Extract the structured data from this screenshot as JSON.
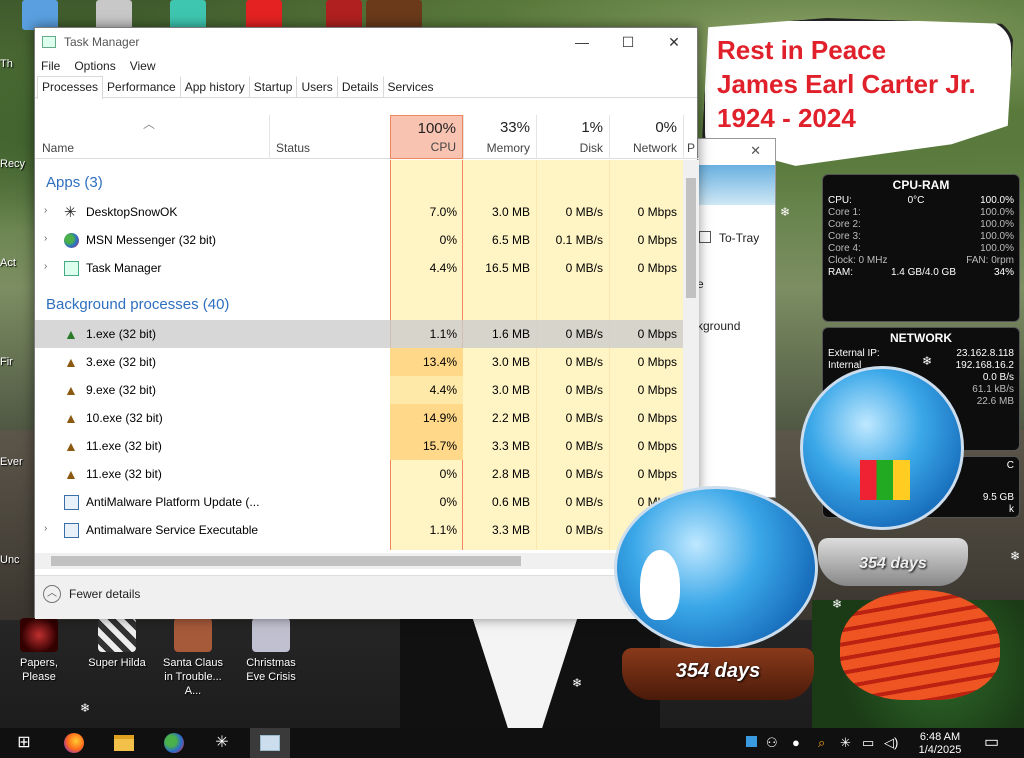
{
  "window": {
    "title": "Task Manager",
    "controls": {
      "minimize": "—",
      "maximize": "☐",
      "close": "✕"
    },
    "menu": [
      "File",
      "Options",
      "View"
    ],
    "tabs": [
      "Processes",
      "Performance",
      "App history",
      "Startup",
      "Users",
      "Details",
      "Services"
    ],
    "active_tab": "Processes"
  },
  "columns": {
    "name": "Name",
    "status": "Status",
    "cpu": {
      "pct": "100%",
      "label": "CPU"
    },
    "memory": {
      "pct": "33%",
      "label": "Memory"
    },
    "disk": {
      "pct": "1%",
      "label": "Disk"
    },
    "network": {
      "pct": "0%",
      "label": "Network"
    },
    "power": "P"
  },
  "groups": {
    "apps": "Apps (3)",
    "background": "Background processes (40)"
  },
  "apps": [
    {
      "name": "DesktopSnowOK",
      "cpu": "7.0%",
      "memory": "3.0 MB",
      "disk": "0 MB/s",
      "network": "0 Mbps",
      "icon": "snowflake-icon"
    },
    {
      "name": "MSN Messenger (32 bit)",
      "cpu": "0%",
      "memory": "6.5 MB",
      "disk": "0.1 MB/s",
      "network": "0 Mbps",
      "icon": "msn-messenger-icon"
    },
    {
      "name": "Task Manager",
      "cpu": "4.4%",
      "memory": "16.5 MB",
      "disk": "0 MB/s",
      "network": "0 Mbps",
      "icon": "task-manager-icon"
    }
  ],
  "background": [
    {
      "name": "1.exe (32 bit)",
      "cpu": "1.1%",
      "memory": "1.6 MB",
      "disk": "0 MB/s",
      "network": "0 Mbps"
    },
    {
      "name": "3.exe (32 bit)",
      "cpu": "13.4%",
      "memory": "3.0 MB",
      "disk": "0 MB/s",
      "network": "0 Mbps"
    },
    {
      "name": "9.exe (32 bit)",
      "cpu": "4.4%",
      "memory": "3.0 MB",
      "disk": "0 MB/s",
      "network": "0 Mbps"
    },
    {
      "name": "10.exe (32 bit)",
      "cpu": "14.9%",
      "memory": "2.2 MB",
      "disk": "0 MB/s",
      "network": "0 Mbps"
    },
    {
      "name": "11.exe (32 bit)",
      "cpu": "15.7%",
      "memory": "3.3 MB",
      "disk": "0 MB/s",
      "network": "0 Mbps"
    },
    {
      "name": "11.exe (32 bit)",
      "cpu": "0%",
      "memory": "2.8 MB",
      "disk": "0 MB/s",
      "network": "0 Mbps"
    },
    {
      "name": "AntiMalware Platform Update (...",
      "cpu": "0%",
      "memory": "0.6 MB",
      "disk": "0 MB/s",
      "network": "0 Mbps"
    },
    {
      "name": "Antimalware Service Executable",
      "cpu": "1.1%",
      "memory": "3.3 MB",
      "disk": "0 MB/s",
      "network": "0 Mbps"
    }
  ],
  "footer": {
    "fewer_details": "Fewer details"
  },
  "behind_window": {
    "to_tray": "To-Tray",
    "text1": "e",
    "text2": "kground",
    "close": "✕"
  },
  "banner": {
    "line1": "Rest in Peace",
    "line2": "James Earl Carter Jr.",
    "line3": "1924 - 2024"
  },
  "cpu_gadget": {
    "title": "CPU-RAM",
    "cpu_label": "CPU:",
    "temp": "0°C",
    "cpu_pct": "100.0%",
    "cores": [
      {
        "label": "Core 1:",
        "value": "100.0%"
      },
      {
        "label": "Core 2:",
        "value": "100.0%"
      },
      {
        "label": "Core 3:",
        "value": "100.0%"
      },
      {
        "label": "Core 4:",
        "value": "100.0%"
      }
    ],
    "clock": "Clock: 0 MHz",
    "fan": "FAN: 0rpm",
    "ram_label": "RAM:",
    "ram_value": "1.4 GB/4.0 GB",
    "ram_pct": "34%"
  },
  "net_gadget": {
    "title": "NETWORK",
    "external_label": "External IP:",
    "external_ip": "23.162.8.118",
    "internal_label": "Internal",
    "internal_ip": "192.168.16.2",
    "rate1": "0.0 B/s",
    "rate2": "61.1 kB/s",
    "rate3": "22.6 MB"
  },
  "side_gadget": {
    "c": "C",
    "gb": "9.5 GB",
    "k": "k"
  },
  "globes": {
    "small": "354 days",
    "large": "354 days"
  },
  "desktop_icons": [
    {
      "label": "Papers, Please"
    },
    {
      "label": "Super Hilda"
    },
    {
      "label": "Santa Claus in Trouble... A..."
    },
    {
      "label": "Christmas Eve Crisis"
    }
  ],
  "left_labels": [
    "Th",
    "Recy",
    "Act",
    "Fir",
    "Ever",
    "Unc"
  ],
  "taskbar": {
    "start": "⊞",
    "apps": [
      "firefox-icon",
      "file-explorer-icon",
      "msn-messenger-icon",
      "desktop-snow-icon",
      "task-manager-icon"
    ],
    "time": "6:48 AM",
    "date": "1/4/2025"
  },
  "colors": {
    "cpu_header": "#f9c3b1",
    "heat_light": "#fff4c4",
    "heat_mid": "#ffe9a8",
    "heat_high": "#ffd88a",
    "group_text": "#2f6fbf",
    "banner_text": "#e0202a"
  }
}
